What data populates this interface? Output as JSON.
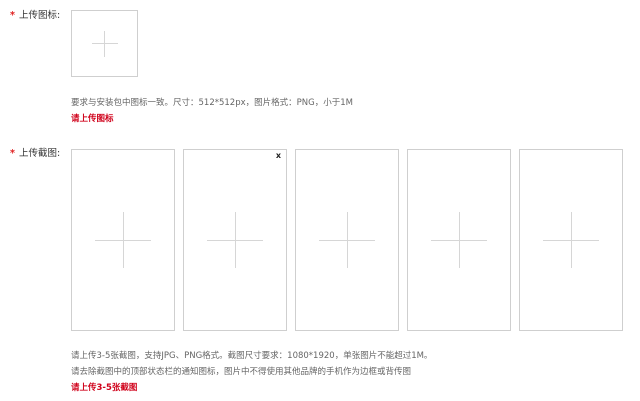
{
  "icon_field": {
    "required_mark": "*",
    "label": "上传图标:",
    "hint": "要求与安装包中图标一致。尺寸：512*512px，图片格式：PNG，小于1M",
    "error": "请上传图标"
  },
  "screenshot_field": {
    "required_mark": "*",
    "label": "上传截图:",
    "slots": [
      {
        "has_close": false
      },
      {
        "has_close": true,
        "close_label": "x"
      },
      {
        "has_close": false
      },
      {
        "has_close": false
      },
      {
        "has_close": false
      }
    ],
    "hint_line1": "请上传3-5张截图，支持JPG、PNG格式。截图尺寸要求：1080*1920，单张图片不能超过1M。",
    "hint_line2": "请去除截图中的顶部状态栏的通知图标，图片中不得使用其他品牌的手机作为边框或背传图",
    "error": "请上传3-5张截图"
  },
  "icons": {
    "upload_plus": "plus-icon",
    "remove": "close-icon"
  },
  "colors": {
    "required": "#e02020",
    "error": "#d0021b",
    "border": "#cfcfcf",
    "hint": "#666666"
  }
}
